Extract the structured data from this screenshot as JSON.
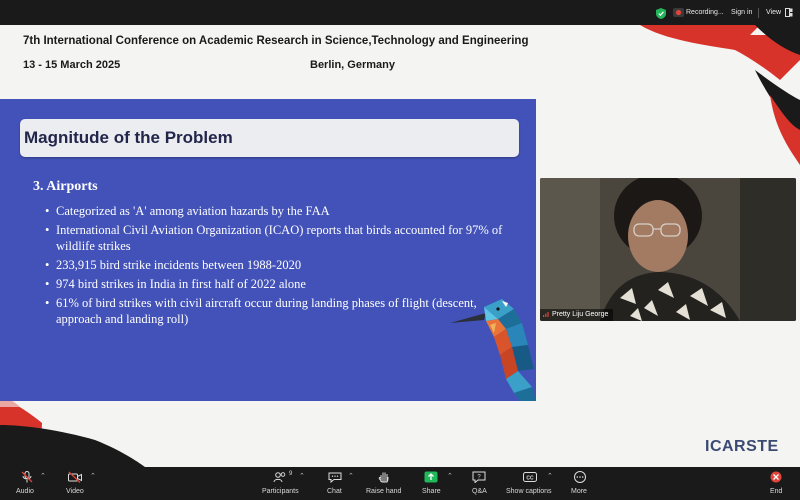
{
  "topbar": {
    "recording_label": "Recording...",
    "signin_label": "Sign in",
    "view_label": "View"
  },
  "conference": {
    "title": "7th International Conference on Academic Research in Science,Technology and Engineering",
    "dates": "13 - 15 March 2025",
    "location": "Berlin, Germany",
    "logo_text": "ICARSTE"
  },
  "slide": {
    "heading": "Magnitude of the Problem",
    "section_title": "3.   Airports",
    "bullets": [
      "Categorized as 'A' among aviation hazards by the FAA",
      "International Civil Aviation Organization (ICAO) reports that birds accounted for 97% of wildlife strikes",
      "233,915 bird strike incidents between 1988-2020",
      "974 bird strikes in India in first half of 2022 alone",
      "61% of bird strikes with civil aircraft occur during landing phases of flight (descent, approach and landing roll)"
    ]
  },
  "participant_video": {
    "name": "Pretty Liju George"
  },
  "toolbar": {
    "audio_label": "Audio",
    "video_label": "Video",
    "participants_label": "Participants",
    "participants_count": "9",
    "chat_label": "Chat",
    "raise_hand_label": "Raise hand",
    "share_label": "Share",
    "qa_label": "Q&A",
    "captions_label": "Show captions",
    "more_label": "More",
    "end_label": "End"
  },
  "colors": {
    "slide_bg": "#4252b8",
    "accent_red": "#d8332a",
    "share_green": "#1fb85a",
    "toolbar_bg": "#1a1a1a"
  }
}
